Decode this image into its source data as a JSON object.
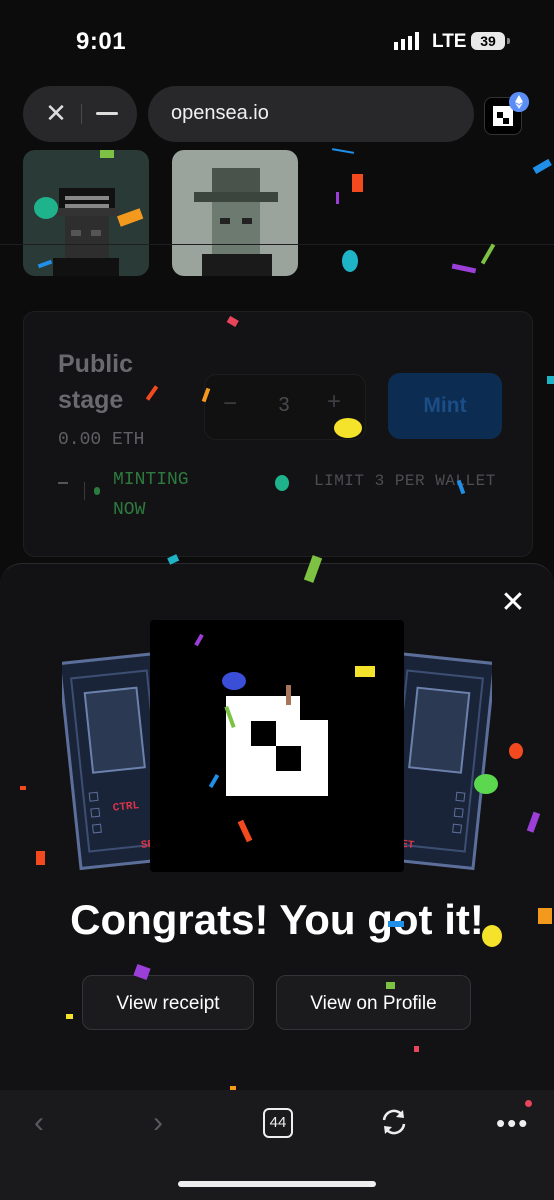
{
  "status_bar": {
    "time": "9:01",
    "network": "LTE",
    "battery": "39"
  },
  "browser": {
    "url": "opensea.io",
    "tab_count": "44"
  },
  "mint_panel": {
    "title": "Public stage",
    "price": "0.00 ETH",
    "status": "MINTING NOW",
    "quantity": "3",
    "minus": "−",
    "plus": "+",
    "mint_label": "Mint",
    "limit": "LIMIT 3 PER WALLET"
  },
  "modal": {
    "close_glyph": "✕",
    "heading": "Congrats! You got it!",
    "view_receipt_label": "View receipt",
    "view_profile_label": "View on Profile"
  },
  "toolbar": {
    "back_glyph": "‹",
    "forward_glyph": "›",
    "more_glyph": "•••"
  },
  "colors": {
    "accent_blue": "#2081e2",
    "mint_disabled": "#0d2c52",
    "minting_green": "#2e7a3e"
  }
}
